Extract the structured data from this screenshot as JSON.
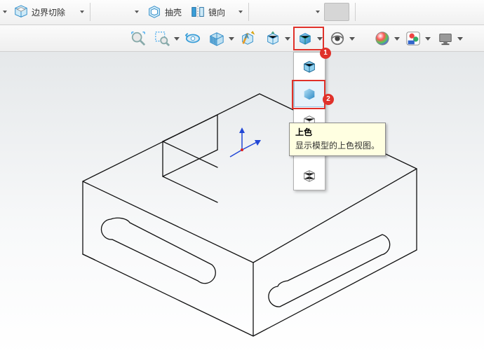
{
  "ribbon": {
    "boundary_cut_label": "边界切除",
    "shell_label": "抽壳",
    "mirror_label": "镜向"
  },
  "toolbar": {
    "zoom_fit_name": "zoom-to-fit-icon",
    "zoom_area_name": "zoom-to-area-icon",
    "prev_view_name": "previous-view-icon",
    "section_name": "section-view-icon",
    "dyn_annot_name": "dynamic-annotation-icon",
    "view_orient_name": "view-orientation-icon",
    "display_style_name": "display-style-icon",
    "hide_show_name": "hide-show-items-icon",
    "edit_appear_name": "edit-appearance-icon",
    "apply_scene_name": "apply-scene-icon",
    "view_setting_name": "view-settings-icon"
  },
  "dropdown": {
    "shaded_edges_name": "shaded-with-edges-icon",
    "shaded_name": "shaded-icon",
    "hidden_removed_name": "hidden-lines-removed-icon",
    "hidden_visible_name": "hidden-lines-visible-icon",
    "wireframe_name": "wireframe-icon"
  },
  "tooltip": {
    "title": "上色",
    "desc": "显示模型的上色视图。"
  },
  "callouts": {
    "one": "1",
    "two": "2"
  }
}
